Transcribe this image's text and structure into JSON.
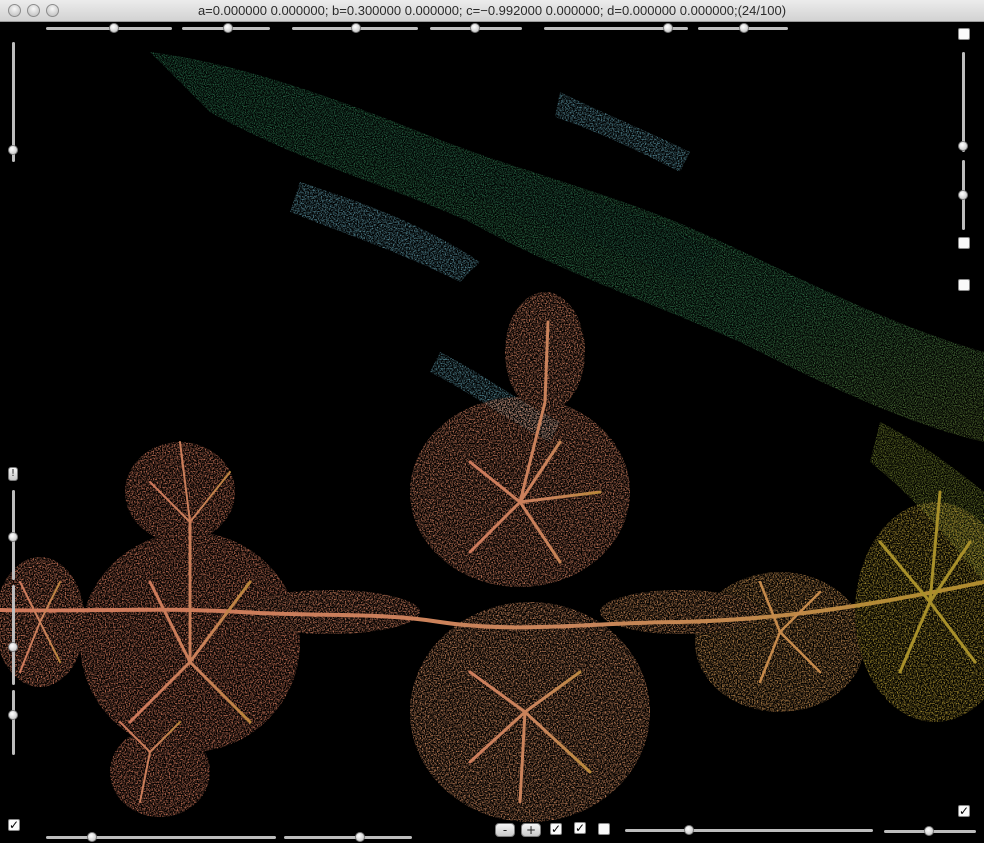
{
  "window": {
    "title": "a=0.000000 0.000000; b=0.300000 0.000000; c=−0.992000 0.000000; d=0.000000 0.000000;(24/100)"
  },
  "controls": {
    "minus_label": "-",
    "plus_label": "+",
    "info_label": "!",
    "check_mark": "✓"
  },
  "colors": {
    "background": "#000000",
    "fractal_green": "#2f7a55",
    "fractal_orange": "#d07a5a",
    "fractal_olive": "#9a8a2a"
  }
}
